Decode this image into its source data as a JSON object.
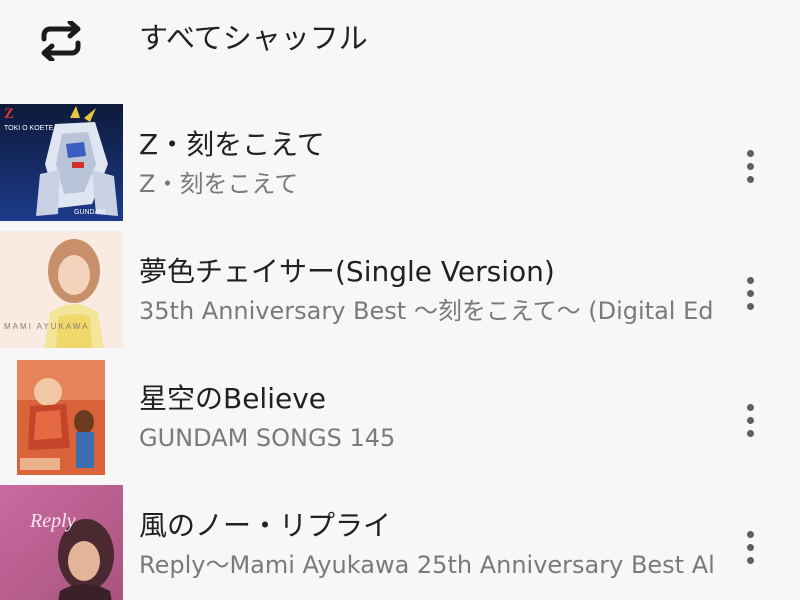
{
  "shuffle": {
    "label": "すべてシャッフル",
    "icon": "shuffle-repeat-icon"
  },
  "tracks": [
    {
      "title": "Z・刻をこえて",
      "subtitle": "Z・刻をこえて",
      "art_icon": "album-art-gundam-z",
      "art_text": [
        "Z",
        "TOKI O KOETE",
        "GUNDAM"
      ],
      "more_icon": "more-vert-icon"
    },
    {
      "title": "夢色チェイサー(Single Version)",
      "subtitle": "35th Anniversary Best 〜刻をこえて〜 (Digital Ed",
      "art_icon": "album-art-mami-ayukawa-35th",
      "art_text": [
        "MAMI AYUKAWA"
      ],
      "more_icon": "more-vert-icon"
    },
    {
      "title": "星空のBelieve",
      "subtitle": "GUNDAM SONGS 145",
      "art_icon": "album-art-gundam-songs",
      "art_text": [],
      "more_icon": "more-vert-icon"
    },
    {
      "title": "風のノー・リプライ",
      "subtitle": "Reply〜Mami Ayukawa 25th Anniversary Best Al",
      "art_icon": "album-art-reply",
      "art_text": [
        "Reply"
      ],
      "more_icon": "more-vert-icon"
    }
  ],
  "colors": {
    "background": "#f7f7f7",
    "title_text": "#212121",
    "subtitle_text": "#7a7a7a",
    "icon": "#606060"
  }
}
